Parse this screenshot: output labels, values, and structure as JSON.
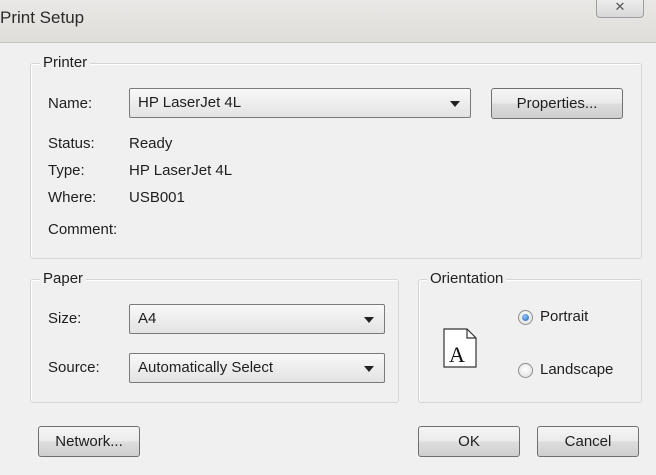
{
  "window": {
    "title": "Print Setup",
    "close_glyph": "✕"
  },
  "printer": {
    "group_label": "Printer",
    "name_label": "Name:",
    "name_value": "HP LaserJet 4L",
    "properties_button": "Properties...",
    "status_label": "Status:",
    "status_value": "Ready",
    "type_label": "Type:",
    "type_value": "HP LaserJet 4L",
    "where_label": "Where:",
    "where_value": "USB001",
    "comment_label": "Comment:",
    "comment_value": ""
  },
  "paper": {
    "group_label": "Paper",
    "size_label": "Size:",
    "size_value": "A4",
    "source_label": "Source:",
    "source_value": "Automatically Select"
  },
  "orientation": {
    "group_label": "Orientation",
    "page_icon": "portrait-page-icon",
    "page_glyph": "A",
    "portrait_label": "Portrait",
    "landscape_label": "Landscape",
    "selected": "portrait"
  },
  "buttons": {
    "network": "Network...",
    "ok": "OK",
    "cancel": "Cancel"
  },
  "colors": {
    "radio_selected": "#1b5fb5",
    "dialog_bg": "#f0f0f0"
  }
}
